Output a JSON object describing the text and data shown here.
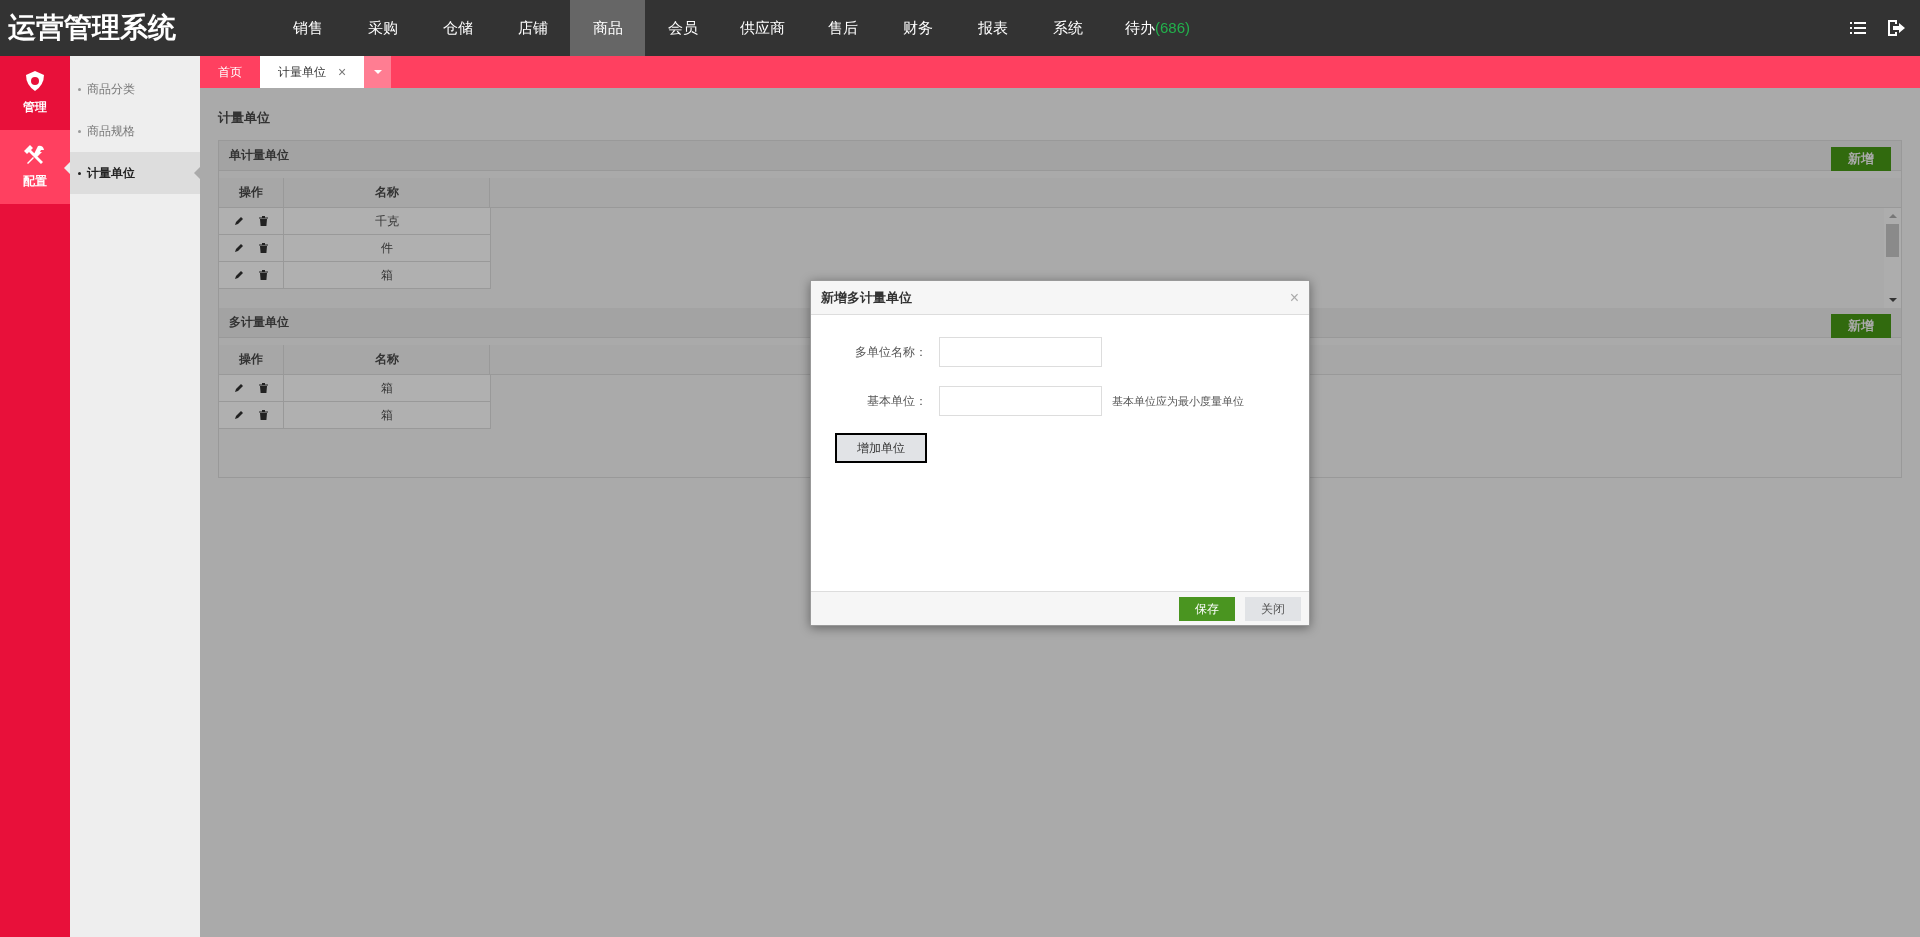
{
  "app_title": "运营管理系统",
  "nav": [
    {
      "label": "销售",
      "selected": false
    },
    {
      "label": "采购",
      "selected": false
    },
    {
      "label": "仓储",
      "selected": false
    },
    {
      "label": "店铺",
      "selected": false
    },
    {
      "label": "商品",
      "selected": true
    },
    {
      "label": "会员",
      "selected": false
    },
    {
      "label": "供应商",
      "selected": false
    },
    {
      "label": "售后",
      "selected": false
    },
    {
      "label": "财务",
      "selected": false
    },
    {
      "label": "报表",
      "selected": false
    },
    {
      "label": "系统",
      "selected": false
    },
    {
      "label": "待办",
      "count": "(686)",
      "selected": false
    }
  ],
  "side_modules": [
    {
      "label": "管理",
      "kind": "manage",
      "selected": false
    },
    {
      "label": "配置",
      "kind": "config",
      "selected": true
    }
  ],
  "submenu": [
    {
      "label": "商品分类",
      "selected": false
    },
    {
      "label": "商品规格",
      "selected": false
    },
    {
      "label": "计量单位",
      "selected": true
    }
  ],
  "tabs": [
    {
      "label": "首页",
      "selected": false
    },
    {
      "label": "计量单位",
      "selected": true,
      "close": "×"
    }
  ],
  "page_title": "计量单位",
  "panels": [
    {
      "title": "单计量单位",
      "add_button": "新增",
      "columns": [
        "操作",
        "名称"
      ],
      "rows": [
        "千克",
        "件",
        "箱"
      ],
      "scrollable": true
    },
    {
      "title": "多计量单位",
      "add_button": "新增",
      "columns": [
        "操作",
        "名称"
      ],
      "rows": [
        "箱",
        "箱"
      ],
      "scrollable": false
    }
  ],
  "dialog": {
    "title": "新增多计量单位",
    "close": "×",
    "fields": [
      {
        "label": "多单位名称："
      },
      {
        "label": "基本单位：",
        "hint": "基本单位应为最小度量单位"
      }
    ],
    "add_unit_button": "增加单位",
    "buttons": [
      {
        "label": "保存",
        "kind": "primary"
      },
      {
        "label": "关闭",
        "kind": "secondary"
      }
    ]
  }
}
